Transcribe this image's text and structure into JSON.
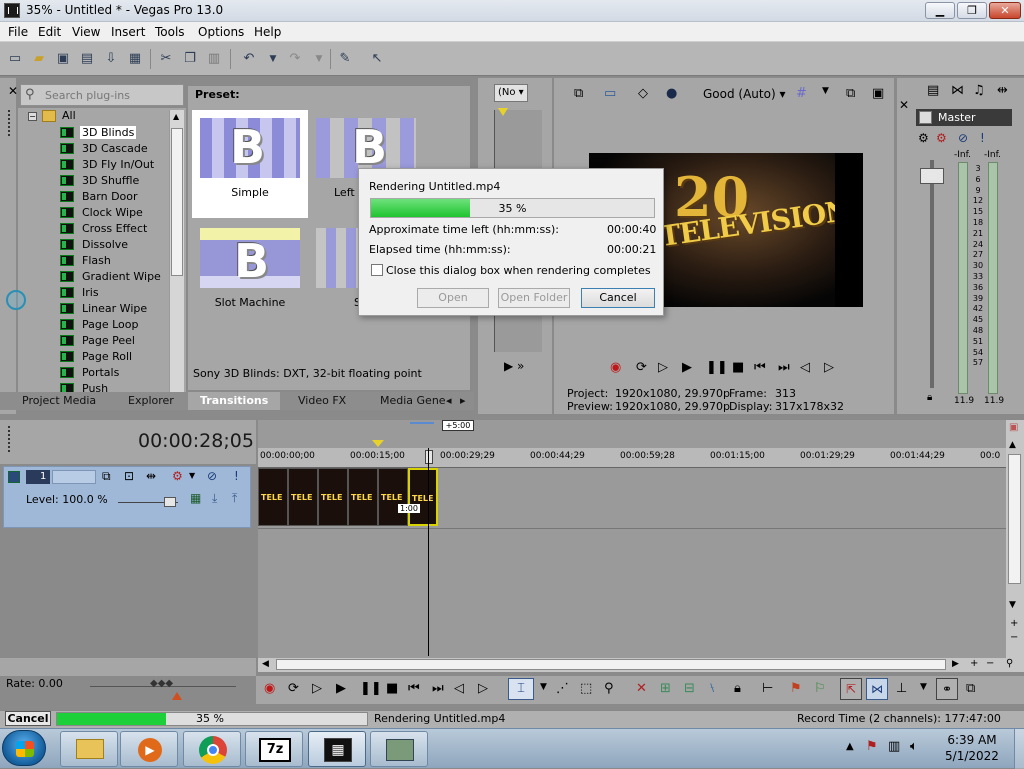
{
  "window": {
    "title": "35% - Untitled * - Vegas Pro 13.0"
  },
  "menu": [
    "File",
    "Edit",
    "View",
    "Insert",
    "Tools",
    "Options",
    "Help"
  ],
  "browser": {
    "search_placeholder": "Search plug-ins",
    "root": "All",
    "items": [
      "3D Blinds",
      "3D Cascade",
      "3D Fly In/Out",
      "3D Shuffle",
      "Barn Door",
      "Clock Wipe",
      "Cross Effect",
      "Dissolve",
      "Flash",
      "Gradient Wipe",
      "Iris",
      "Linear Wipe",
      "Page Loop",
      "Page Peel",
      "Page Roll",
      "Portals",
      "Push"
    ],
    "selected": "3D Blinds",
    "preset_label": "Preset:",
    "presets": [
      "Simple",
      "Left",
      "Slot Machine",
      "S"
    ],
    "description": "Sony 3D Blinds: DXT, 32-bit floating point",
    "tabs": [
      "Project Media",
      "Explorer",
      "Transitions",
      "Video FX",
      "Media Gene"
    ]
  },
  "preview": {
    "dropdown": "(No",
    "quality": "Good (Auto)",
    "video_text": "TELEVISION",
    "video_big": "20",
    "project_label": "Project:",
    "project_value": "1920x1080, 29.970p",
    "preview_label": "Preview:",
    "preview_value": "1920x1080, 29.970p",
    "frame_label": "Frame:",
    "frame_value": "313",
    "display_label": "Display:",
    "display_value": "317x178x32"
  },
  "master": {
    "label": "Master",
    "meter_top_left": "-Inf.",
    "meter_top_right": "-Inf.",
    "scale": [
      "3",
      "6",
      "9",
      "12",
      "15",
      "18",
      "21",
      "24",
      "27",
      "30",
      "33",
      "36",
      "39",
      "42",
      "45",
      "48",
      "51",
      "54",
      "57"
    ],
    "value_left": "11.9",
    "value_right": "11.9"
  },
  "timeline": {
    "timecode": "00:00:28;05",
    "track_number": "1",
    "level": "Level: 100.0 %",
    "edge_marker": "+5:00",
    "ruler": [
      "00:00:00;00",
      "00:00:15;00",
      "00:00:29;29",
      "00:00:44;29",
      "00:00:59;28",
      "00:01:15;00",
      "00:01:29;29",
      "00:01:44;29",
      "00:0"
    ],
    "clip_text": "TELE",
    "clip_marker": "1:00",
    "rate": "Rate: 0.00"
  },
  "dialog": {
    "title": "Rendering Untitled.mp4",
    "progress_pct": 35,
    "progress_label": "35 %",
    "time_left_label": "Approximate time left (hh:mm:ss):",
    "time_left": "00:00:40",
    "elapsed_label": "Elapsed time (hh:mm:ss):",
    "elapsed": "00:00:21",
    "close_when_done": "Close this dialog box when rendering completes",
    "open": "Open",
    "open_folder": "Open Folder",
    "cancel": "Cancel"
  },
  "status": {
    "cancel": "Cancel",
    "progress_label": "35 %",
    "text": "Rendering Untitled.mp4",
    "record": "Record Time (2 channels): 177:47:00"
  },
  "taskbar": {
    "time": "6:39 AM",
    "date": "5/1/2022",
    "apps": [
      "explorer",
      "media-player",
      "chrome",
      "7zip",
      "vegas",
      "app"
    ]
  }
}
